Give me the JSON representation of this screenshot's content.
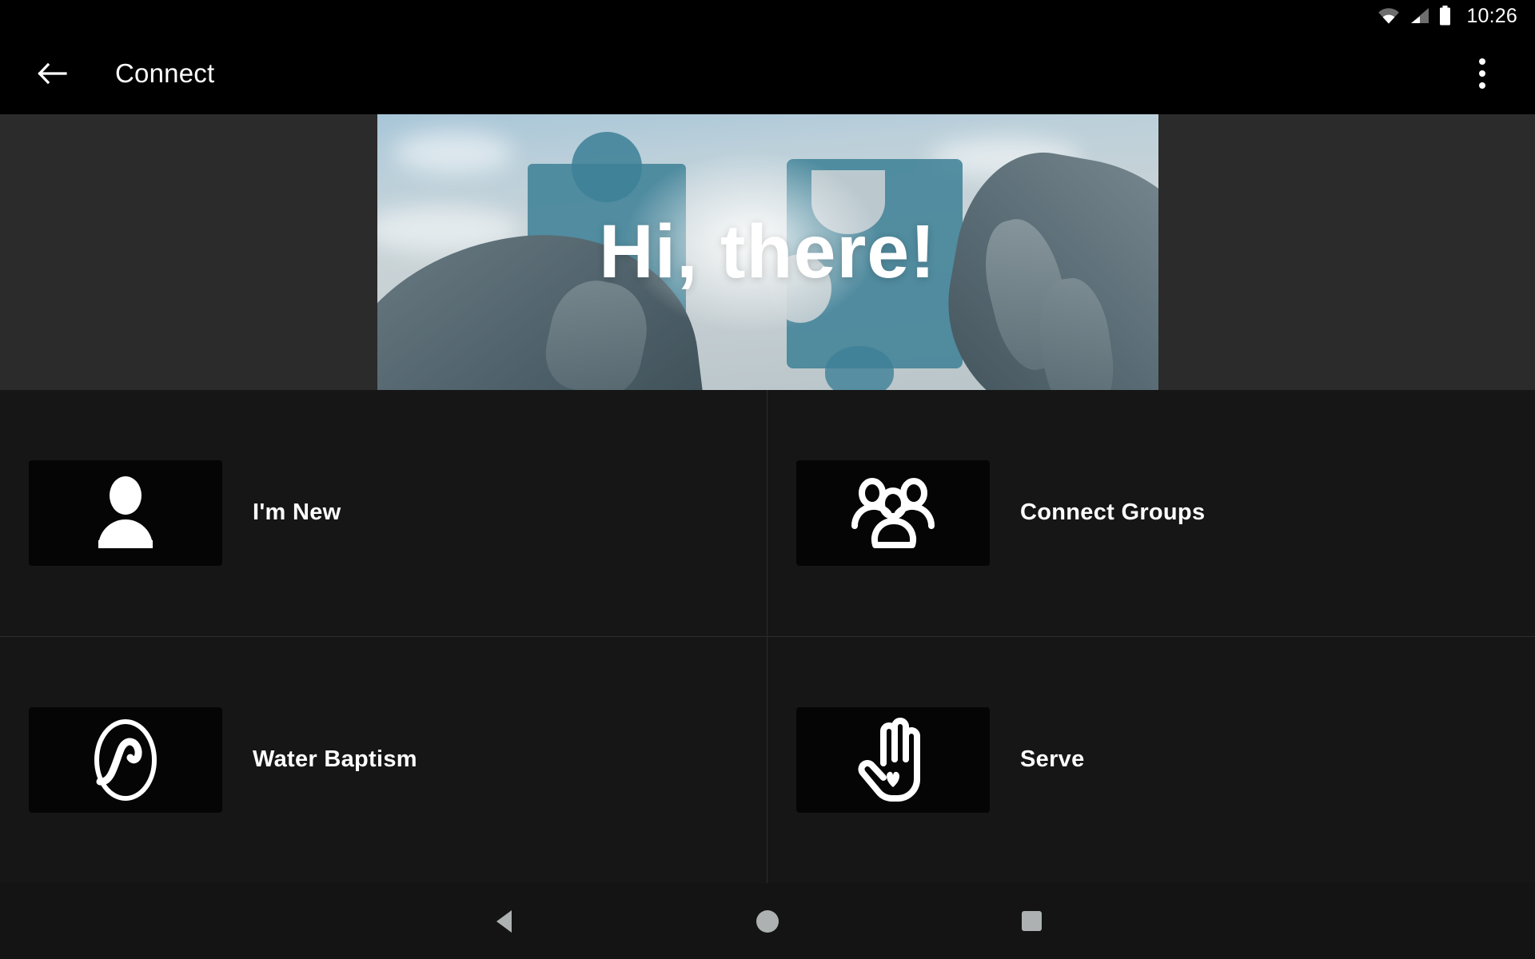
{
  "statusbar": {
    "time": "10:26",
    "icons": [
      "wifi-icon",
      "cellular-signal-icon",
      "battery-icon"
    ]
  },
  "appbar": {
    "back_icon": "back-arrow-icon",
    "title": "Connect",
    "overflow_icon": "more-vertical-icon"
  },
  "hero": {
    "headline": "Hi, there!",
    "image_description": "two hands joining teal puzzle pieces against a blue sky",
    "puzzle_color": "#3e8096",
    "sky_color": "#bcd0da"
  },
  "menu": {
    "items": [
      {
        "label": "I'm New",
        "icon": "person-icon"
      },
      {
        "label": "Connect Groups",
        "icon": "people-group-icon"
      },
      {
        "label": "Water Baptism",
        "icon": "water-wave-circle-icon"
      },
      {
        "label": "Serve",
        "icon": "hand-heart-icon"
      }
    ]
  },
  "navbar": {
    "back_label": "back-triangle-icon",
    "home_label": "home-circle-icon",
    "recents_label": "recents-square-icon"
  },
  "colors": {
    "background": "#000000",
    "surface": "#161616",
    "tile": "#050505",
    "divider": "#2c2c2c",
    "text": "#ffffff",
    "nav_icon": "#adb1b1"
  }
}
